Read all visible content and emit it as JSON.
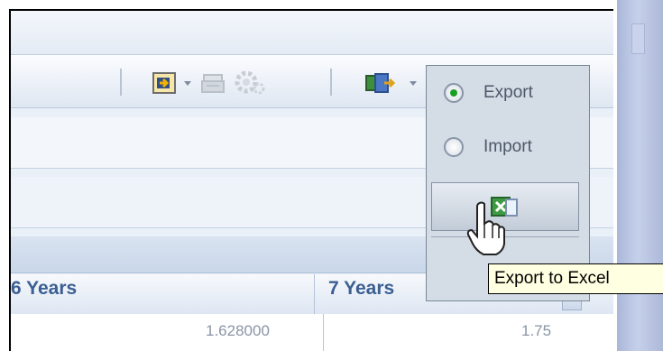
{
  "toolbar": {
    "icons": [
      "import-image-icon",
      "printer-icon",
      "gear-icon",
      "export-dropdown-icon"
    ]
  },
  "export_menu": {
    "options": [
      {
        "label": "Export",
        "selected": true
      },
      {
        "label": "Import",
        "selected": false
      }
    ],
    "excel_button_icon": "excel-icon",
    "tooltip": "Export to Excel"
  },
  "grid": {
    "columns": [
      "6 Years",
      "7 Years"
    ],
    "row": [
      "1.628000",
      "1.75"
    ]
  },
  "colors": {
    "header_text": "#3b5f93",
    "tooltip_bg": "#ffffe1",
    "radio_selected": "#18a020"
  }
}
